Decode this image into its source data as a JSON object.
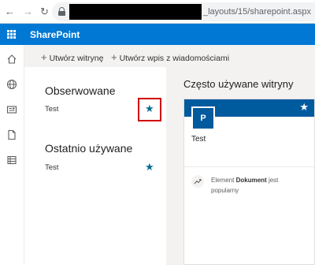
{
  "browser": {
    "url_suffix": "_layouts/15/sharepoint.aspx",
    "icons": [
      "back-arrow-icon",
      "forward-arrow-icon",
      "reload-icon",
      "lock-icon"
    ]
  },
  "suite_bar": {
    "title": "SharePoint",
    "color": "#0078d4",
    "icon": "waffle-icon"
  },
  "left_rail": {
    "icons": [
      "home-icon",
      "globe-icon",
      "news-icon",
      "document-icon",
      "list-icon"
    ]
  },
  "command_bar": {
    "create_site": "Utwórz witrynę",
    "create_news": "Utwórz wpis z wiadomościami"
  },
  "followed": {
    "heading": "Obserwowane",
    "items": [
      {
        "label": "Test",
        "icon": "star-icon"
      }
    ]
  },
  "recent": {
    "heading": "Ostatnio używane",
    "items": [
      {
        "label": "Test",
        "icon": "star-icon"
      }
    ]
  },
  "frequent": {
    "heading": "Często używane witryny",
    "card": {
      "logo_letter": "P",
      "title": "Test",
      "activity_prefix": "Element",
      "activity_bold": "Dokument",
      "activity_suffix": "jest popularny",
      "header_color": "#005a9e"
    }
  },
  "accent_colors": {
    "star": "#046e8f",
    "highlight": "#d00000"
  }
}
